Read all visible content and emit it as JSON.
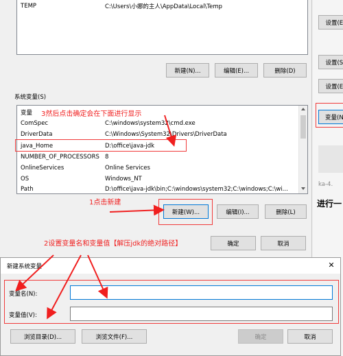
{
  "user_vars": {
    "row": {
      "name": "TEMP",
      "value": "C:\\Users\\小娜的主人\\AppData\\Local\\Temp"
    },
    "buttons": {
      "new": "新建(N)...",
      "edit": "编辑(E)...",
      "delete": "删除(D)"
    }
  },
  "system_vars": {
    "title": "系统变量(S)",
    "header": {
      "name": "变量"
    },
    "rows": [
      {
        "name": "ComSpec",
        "value": "C:\\windows\\system32\\cmd.exe"
      },
      {
        "name": "DriverData",
        "value": "C:\\Windows\\System32\\Drivers\\DriverData"
      },
      {
        "name": "java_Home",
        "value": "D:\\office\\java-jdk"
      },
      {
        "name": "NUMBER_OF_PROCESSORS",
        "value": "8"
      },
      {
        "name": "OnlineServices",
        "value": "Online Services"
      },
      {
        "name": "OS",
        "value": "Windows_NT"
      },
      {
        "name": "Path",
        "value": "D:\\office\\java-jdk\\bin;C:\\windows\\system32;C:\\windows;C:\\wi..."
      }
    ],
    "buttons": {
      "new": "新建(W)...",
      "edit": "编辑(I)...",
      "delete": "删除(L)"
    }
  },
  "dialog_buttons": {
    "ok": "确定",
    "cancel": "取消"
  },
  "annotations": {
    "note3": "3然后点击确定会在下面进行显示",
    "note1": "1点击新建",
    "note2": "2设置变量名和变量值【解压jdk的绝对路径】"
  },
  "new_var_dialog": {
    "title": "新建系统变量",
    "close_glyph": "✕",
    "name_label": "变量名(N):",
    "value_label": "变量值(V):",
    "name_value": "",
    "value_value": "",
    "buttons": {
      "browse_dir": "浏览目录(D)...",
      "browse_file": "浏览文件(F)...",
      "ok": "确定",
      "cancel": "取消"
    }
  },
  "right_panel": {
    "set1": "设置(E)",
    "set2": "设置(S)",
    "set3": "设置(E)",
    "env_var": "变量(N)",
    "hint": "ka-4.",
    "cut_text": "进行一"
  },
  "colors": {
    "annotation_red": "#f01f1f",
    "selection_blue": "#0078d7",
    "window_bg": "#f0f0f0"
  }
}
